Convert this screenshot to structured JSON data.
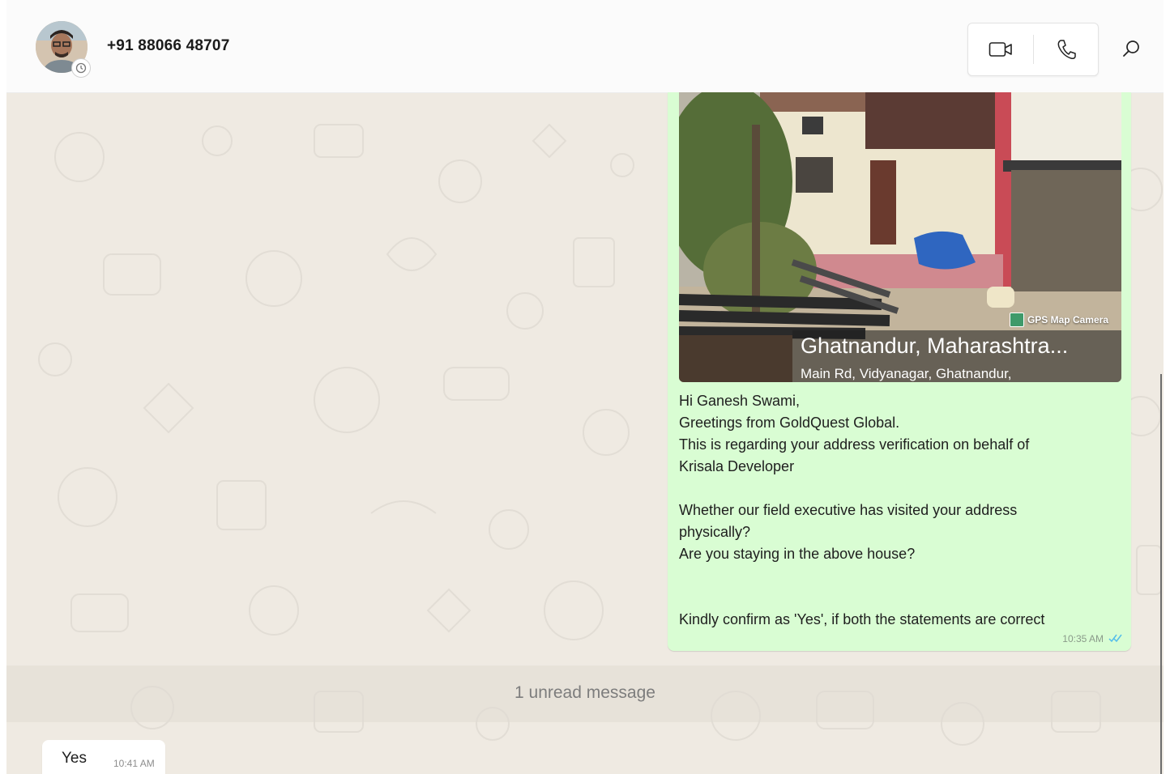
{
  "header": {
    "contact_name": "+91 88066 48707",
    "avatar_icon": "profile-photo",
    "avatar_status_icon": "clock-icon",
    "video_call_icon": "video-camera-icon",
    "voice_call_icon": "phone-icon",
    "search_icon": "search-icon"
  },
  "outgoing_message": {
    "photo": {
      "watermark": "GPS Map Camera",
      "location_title": "Ghatnandur, Maharashtra...",
      "location_address": "Main Rd, Vidyanagar, Ghatnandur,"
    },
    "lines": {
      "l1": "Hi Ganesh Swami,",
      "l2": "Greetings from GoldQuest Global.",
      "l3": "This is regarding your address verification on behalf of",
      "l4": "Krisala Developer",
      "l5": "Whether our field executive has visited your address",
      "l6": "physically?",
      "l7": "Are you staying in the above house?",
      "l8": "Kindly confirm as 'Yes', if both the statements are correct"
    },
    "time": "10:35 AM",
    "status_icon": "double-check-read-icon",
    "bubble_color": "#d9fdd3"
  },
  "unread_banner": "1 unread message",
  "incoming_message": {
    "text": "Yes",
    "time": "10:41 AM"
  },
  "colors": {
    "wallpaper": "#efeae2",
    "read_tick": "#53bdeb"
  }
}
